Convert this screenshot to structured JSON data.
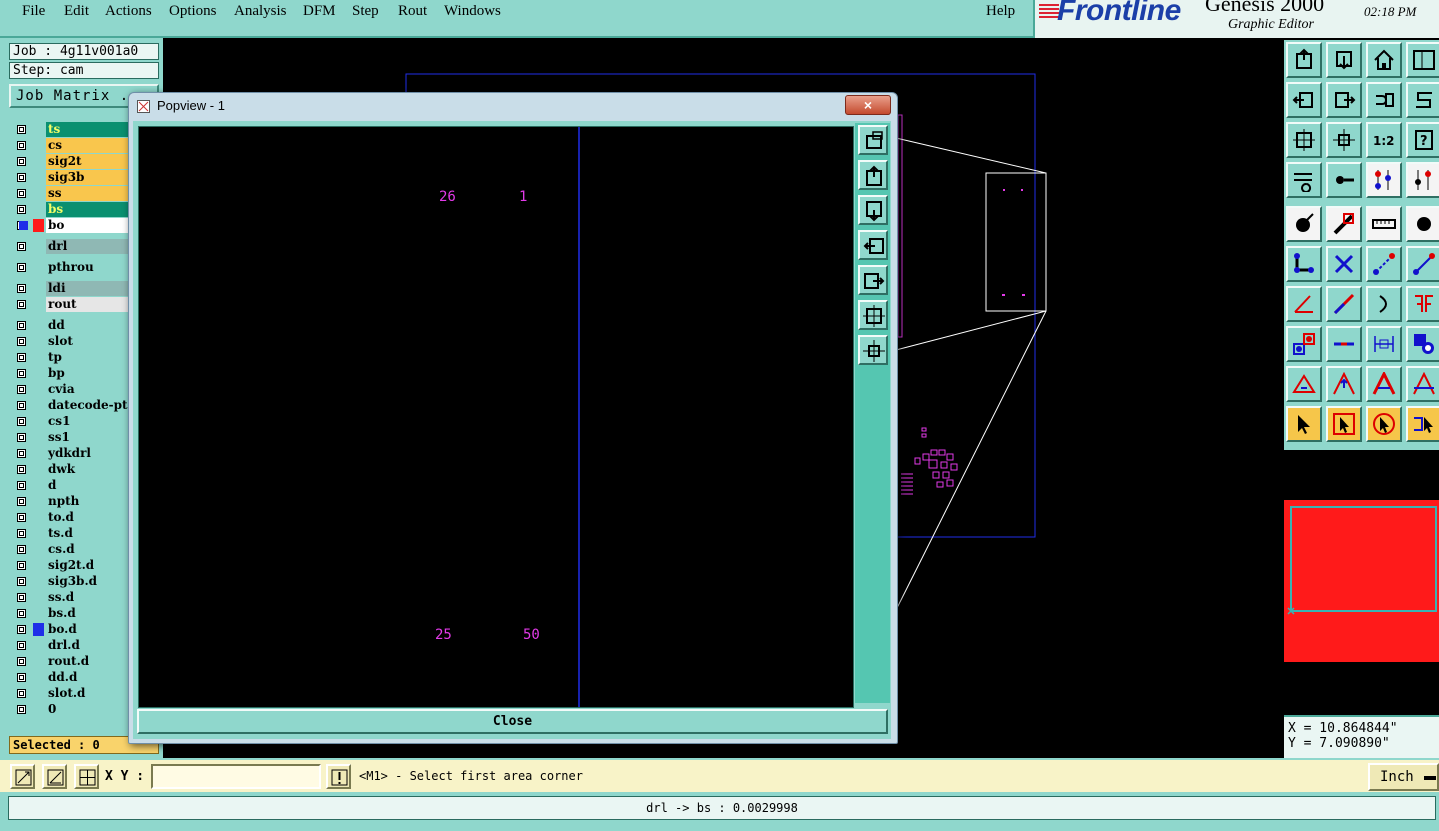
{
  "menu": [
    "File",
    "Edit",
    "Actions",
    "Options",
    "Analysis",
    "DFM",
    "Step",
    "Rout",
    "Windows"
  ],
  "help_label": "Help",
  "brand": {
    "logo": "Frontline",
    "product": "Genesis 2000",
    "subtitle": "Graphic Editor",
    "time": "02:18 PM"
  },
  "job": {
    "job_label": "Job : 4g11v001a0",
    "step_label": "Step: cam",
    "matrix_button": "Job Matrix ..."
  },
  "layers": [
    {
      "name": "ts",
      "color": "#0a9070",
      "text_color": "#f4ff66"
    },
    {
      "name": "cs",
      "color": "#f9c64d"
    },
    {
      "name": "sig2t",
      "color": "#f9c64d"
    },
    {
      "name": "sig3b",
      "color": "#f9c64d"
    },
    {
      "name": "ss",
      "color": "#f9c64d"
    },
    {
      "name": "bs",
      "color": "#0a9070",
      "text_color": "#f4ff66"
    },
    {
      "name": "bo",
      "color": "#ffffff",
      "active": true
    },
    {
      "name": "drl",
      "color": "#8fb8b4"
    },
    {
      "name": "pthrou",
      "color": "#8fd7cc"
    },
    {
      "name": "ldi",
      "color": "#8fb8b4"
    },
    {
      "name": "rout",
      "color": "#e6e6e6"
    },
    {
      "name": "dd",
      "color": "#8fd7cc"
    },
    {
      "name": "slot",
      "color": "#8fd7cc"
    },
    {
      "name": "tp",
      "color": "#8fd7cc"
    },
    {
      "name": "bp",
      "color": "#8fd7cc"
    },
    {
      "name": "cvia",
      "color": "#8fd7cc"
    },
    {
      "name": "datecode-pt",
      "color": "#8fd7cc"
    },
    {
      "name": "cs1",
      "color": "#8fd7cc"
    },
    {
      "name": "ss1",
      "color": "#8fd7cc"
    },
    {
      "name": "ydkdrl",
      "color": "#8fd7cc"
    },
    {
      "name": "dwk",
      "color": "#8fd7cc"
    },
    {
      "name": "d",
      "color": "#8fd7cc"
    },
    {
      "name": "npth",
      "color": "#8fd7cc"
    },
    {
      "name": "to.d",
      "color": "#8fd7cc"
    },
    {
      "name": "ts.d",
      "color": "#8fd7cc"
    },
    {
      "name": "cs.d",
      "color": "#8fd7cc"
    },
    {
      "name": "sig2t.d",
      "color": "#8fd7cc"
    },
    {
      "name": "sig3b.d",
      "color": "#8fd7cc"
    },
    {
      "name": "ss.d",
      "color": "#8fd7cc"
    },
    {
      "name": "bs.d",
      "color": "#8fd7cc"
    },
    {
      "name": "bo.d",
      "color": "#8fd7cc",
      "marker": "#1f2ee8"
    },
    {
      "name": "drl.d",
      "color": "#8fd7cc"
    },
    {
      "name": "rout.d",
      "color": "#8fd7cc"
    },
    {
      "name": "dd.d",
      "color": "#8fd7cc"
    },
    {
      "name": "slot.d",
      "color": "#8fd7cc"
    },
    {
      "name": "0",
      "color": "#8fd7cc"
    }
  ],
  "selected_label": "Selected : 0",
  "popview": {
    "title": "Popview - 1",
    "close_x": "×",
    "close_button": "Close",
    "labels": [
      "26",
      "1",
      "25",
      "50"
    ],
    "side_tools": [
      "zoom-home-icon",
      "pan-up-icon",
      "pan-down-icon",
      "pan-left-icon",
      "pan-right-icon",
      "zoom-fit-icon",
      "zoom-center-icon"
    ]
  },
  "coords": {
    "x": "X = 10.864844\"",
    "y": "Y = 7.090890\""
  },
  "command": {
    "xy_label": "X Y :",
    "xy_value": "",
    "message": "<M1> - Select first area corner",
    "unit": "Inch"
  },
  "status_text": "drl -> bs : 0.0029998",
  "colors": {
    "panel": "#8fd7cc",
    "magenta": "#e23ae8",
    "board_outline": "#1f2ee8"
  }
}
